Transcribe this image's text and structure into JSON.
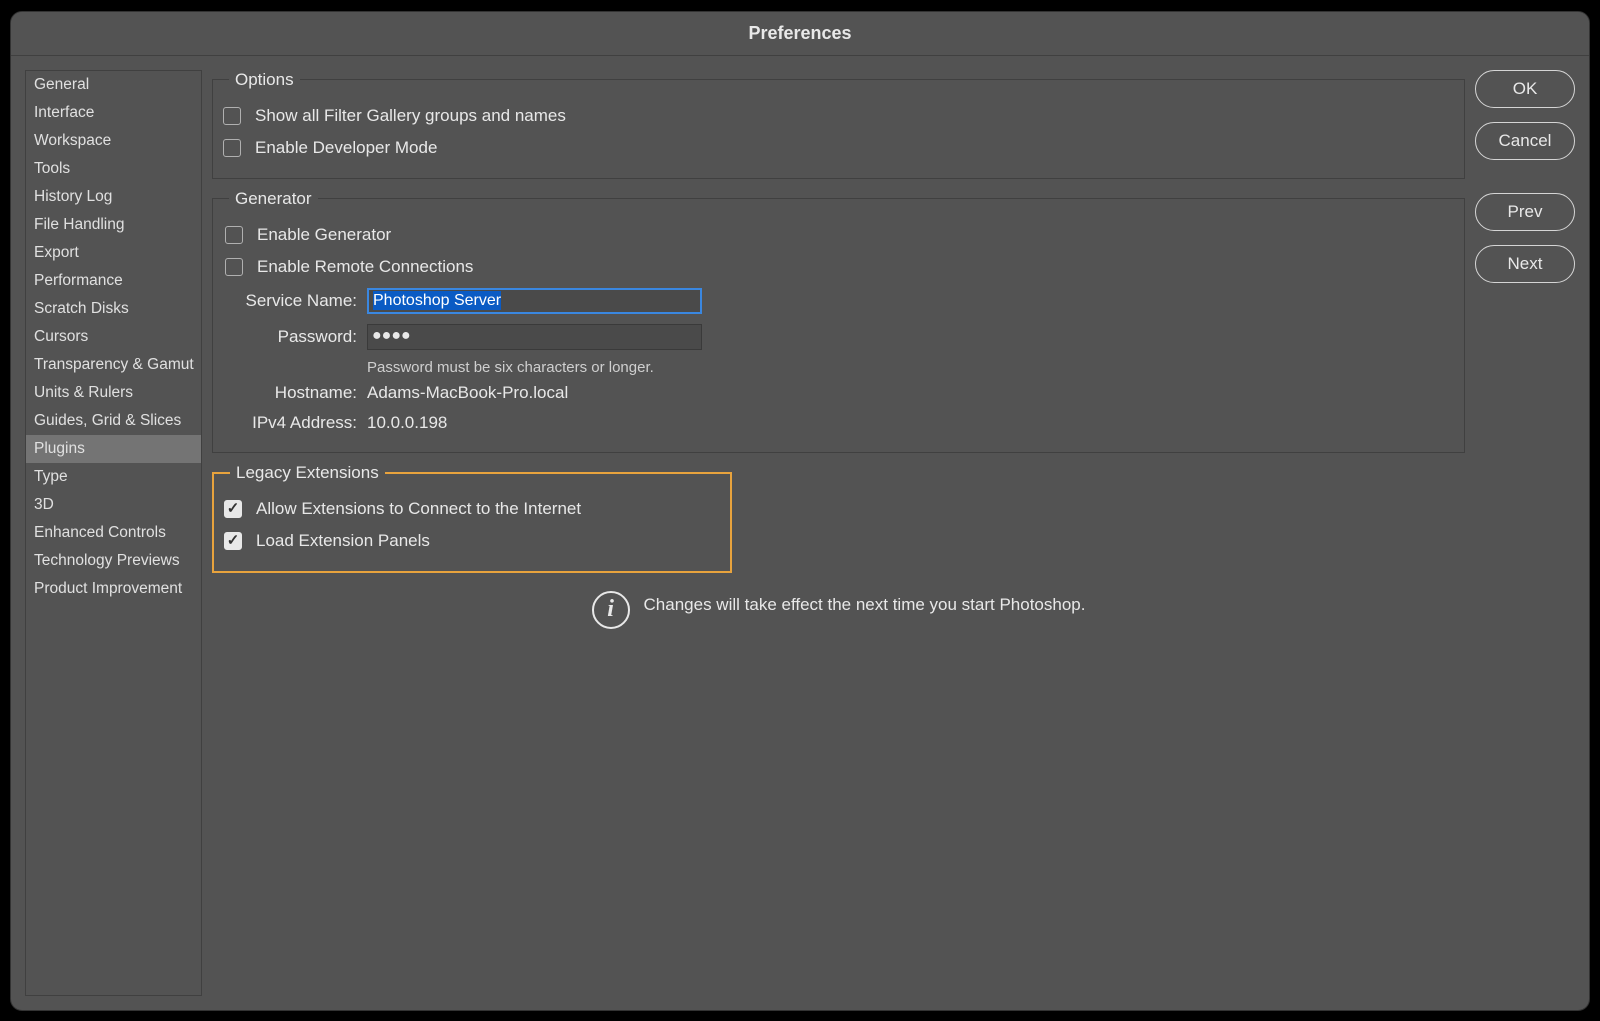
{
  "window": {
    "title": "Preferences"
  },
  "sidebar": {
    "items": [
      {
        "label": "General",
        "selected": false
      },
      {
        "label": "Interface",
        "selected": false
      },
      {
        "label": "Workspace",
        "selected": false
      },
      {
        "label": "Tools",
        "selected": false
      },
      {
        "label": "History Log",
        "selected": false
      },
      {
        "label": "File Handling",
        "selected": false
      },
      {
        "label": "Export",
        "selected": false
      },
      {
        "label": "Performance",
        "selected": false
      },
      {
        "label": "Scratch Disks",
        "selected": false
      },
      {
        "label": "Cursors",
        "selected": false
      },
      {
        "label": "Transparency & Gamut",
        "selected": false
      },
      {
        "label": "Units & Rulers",
        "selected": false
      },
      {
        "label": "Guides, Grid & Slices",
        "selected": false
      },
      {
        "label": "Plugins",
        "selected": true
      },
      {
        "label": "Type",
        "selected": false
      },
      {
        "label": "3D",
        "selected": false
      },
      {
        "label": "Enhanced Controls",
        "selected": false
      },
      {
        "label": "Technology Previews",
        "selected": false
      },
      {
        "label": "Product Improvement",
        "selected": false
      }
    ]
  },
  "buttons": {
    "ok": "OK",
    "cancel": "Cancel",
    "prev": "Prev",
    "next": "Next"
  },
  "options": {
    "legend": "Options",
    "show_filter_gallery": {
      "label": "Show all Filter Gallery groups and names",
      "checked": false
    },
    "developer_mode": {
      "label": "Enable Developer Mode",
      "checked": false
    }
  },
  "generator": {
    "legend": "Generator",
    "enable_generator": {
      "label": "Enable Generator",
      "checked": false
    },
    "enable_remote": {
      "label": "Enable Remote Connections",
      "checked": false
    },
    "service_name": {
      "label": "Service Name:",
      "value": "Photoshop Server"
    },
    "password": {
      "label": "Password:",
      "value": "●●●●"
    },
    "password_hint": "Password must be six characters or longer.",
    "hostname": {
      "label": "Hostname:",
      "value": "Adams-MacBook-Pro.local"
    },
    "ipv4": {
      "label": "IPv4 Address:",
      "value": "10.0.0.198"
    }
  },
  "legacy": {
    "legend": "Legacy Extensions",
    "allow_internet": {
      "label": "Allow Extensions to Connect to the Internet",
      "checked": true
    },
    "load_panels": {
      "label": "Load Extension Panels",
      "checked": true
    }
  },
  "info": {
    "text": "Changes will take effect the next time you start Photoshop."
  }
}
